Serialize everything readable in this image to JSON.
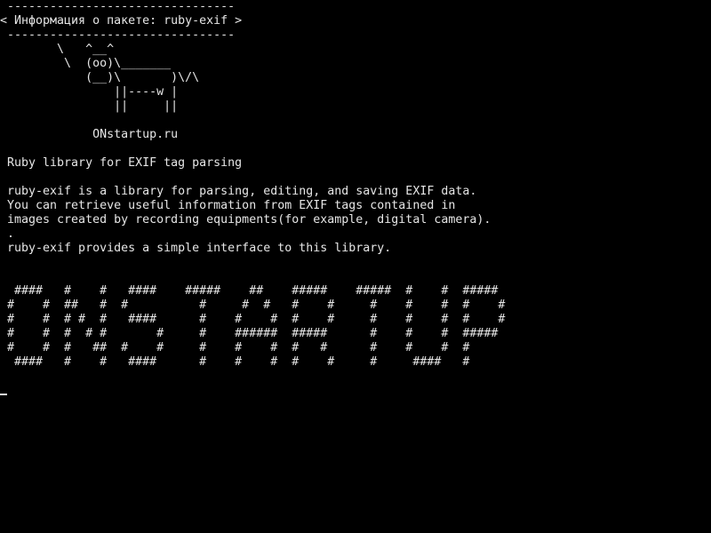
{
  "terminal": {
    "lines": [
      " --------------------------------",
      "< Информация о пакете: ruby-exif >",
      " --------------------------------",
      "        \\   ^__^",
      "         \\  (oo)\\_______",
      "            (__)\\       )\\/\\",
      "                ||----w |",
      "                ||     ||",
      "",
      "             ONstartup.ru",
      "",
      " Ruby library for EXIF tag parsing",
      "",
      " ruby-exif is a library for parsing, editing, and saving EXIF data.",
      " You can retrieve useful information from EXIF tags contained in",
      " images created by recording equipments(for example, digital camera).",
      " .",
      " ruby-exif provides a simple interface to this library.",
      "",
      "",
      "  ####   #    #   ####    #####    ##    #####    #####  #    #  #####",
      " #    #  ##   #  #          #     #  #   #    #     #    #    #  #    #",
      " #    #  # #  #   ####      #    #    #  #    #     #    #    #  #    #",
      " #    #  #  # #       #     #    ######  #####      #    #    #  #####",
      " #    #  #   ##  #    #     #    #    #  #   #      #    #    #  #",
      "  ####   #    #   ####      #    #    #  #    #     #     ####   #"
    ]
  },
  "colors": {
    "background": "#000000",
    "foreground": "#e6e6e6"
  }
}
